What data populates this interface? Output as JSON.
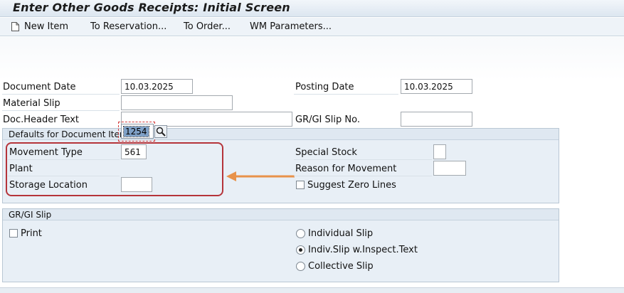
{
  "window": {
    "title": "Enter Other Goods Receipts: Initial Screen"
  },
  "toolbar": {
    "new_item": "New Item",
    "to_reservation": "To Reservation...",
    "to_order": "To Order...",
    "wm_parameters": "WM Parameters..."
  },
  "header": {
    "document_date_label": "Document Date",
    "document_date": "10.03.2025",
    "posting_date_label": "Posting Date",
    "posting_date": "10.03.2025",
    "material_slip_label": "Material Slip",
    "material_slip": "",
    "doc_header_text_label": "Doc.Header Text",
    "doc_header_text": "",
    "gr_gi_slip_no_label": "GR/GI Slip No.",
    "gr_gi_slip_no": ""
  },
  "defaults": {
    "title": "Defaults for Document Items",
    "movement_type_label": "Movement Type",
    "movement_type": "561",
    "plant_label": "Plant",
    "plant": "1254",
    "storage_location_label": "Storage Location",
    "storage_location": "",
    "special_stock_label": "Special Stock",
    "special_stock": "",
    "reason_label": "Reason for Movement",
    "reason": "",
    "suggest_zero_lines_label": "Suggest Zero Lines",
    "suggest_zero_lines": false
  },
  "slip": {
    "title": "GR/GI Slip",
    "print_label": "Print",
    "print": false,
    "individual_slip_label": "Individual Slip",
    "indiv_inspect_label": "Indiv.Slip w.Inspect.Text",
    "collective_slip_label": "Collective Slip",
    "selected": "Indiv.Slip w.Inspect.Text"
  },
  "colors": {
    "highlight_border": "#b5343a",
    "arrow": "#e8924a",
    "selection": "#7fa1c7"
  },
  "icons": {
    "new_item": "document-icon",
    "search_help": "magnifier-icon"
  }
}
